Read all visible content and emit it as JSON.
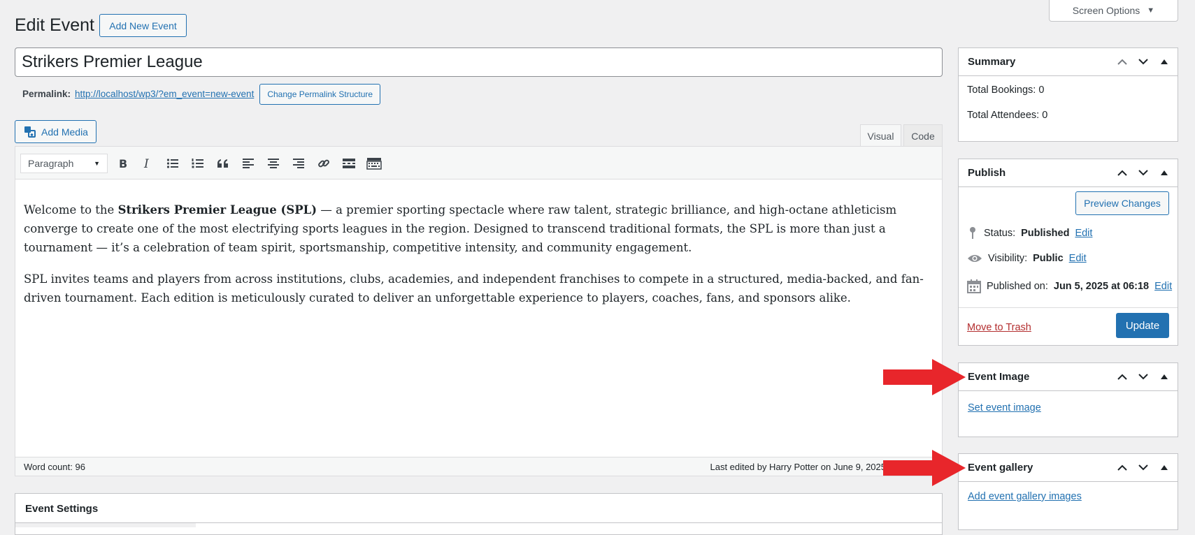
{
  "header": {
    "title": "Edit Event",
    "add_new_label": "Add New Event",
    "screen_options_label": "Screen Options"
  },
  "post": {
    "title_value": "Strikers Premier League",
    "permalink_label": "Permalink:",
    "permalink_url": "http://localhost/wp3/?em_event=new-event",
    "change_permalink_label": "Change Permalink Structure"
  },
  "editor": {
    "add_media_label": "Add Media",
    "tabs": {
      "visual": "Visual",
      "code": "Code"
    },
    "format_select_value": "Paragraph",
    "paragraph1": {
      "pre": "Welcome to the ",
      "bold": "Strikers Premier League (SPL)",
      "post": " — a premier sporting spectacle where raw talent, strategic brilliance, and high-octane athleticism converge to create one of the most electrifying sports leagues in the region. Designed to transcend traditional formats, the SPL is more than just a tournament — it’s a celebration of team spirit, sportsmanship, competitive intensity, and community engagement."
    },
    "paragraph2": "SPL invites teams and players from across institutions, clubs, academies, and independent franchises to compete in a structured, media-backed, and fan-driven tournament. Each edition is meticulously curated to deliver an unforgettable experience to players, coaches, fans, and sponsors alike.",
    "word_count": "Word count: 96",
    "last_edited": "Last edited by Harry Potter on June 9, 2025"
  },
  "event_settings": {
    "title": "Event Settings"
  },
  "sidebar": {
    "summary": {
      "title": "Summary",
      "total_bookings": "Total Bookings: 0",
      "total_attendees": "Total Attendees: 0"
    },
    "publish": {
      "title": "Publish",
      "preview_label": "Preview Changes",
      "status_label": "Status:",
      "status_value": "Published",
      "visibility_label": "Visibility:",
      "visibility_value": "Public",
      "published_label": "Published on:",
      "published_value": "Jun 5, 2025 at 06:18",
      "edit_label": "Edit",
      "trash_label": "Move to Trash",
      "update_label": "Update"
    },
    "event_image": {
      "title": "Event Image",
      "set_label": "Set event image"
    },
    "event_gallery": {
      "title": "Event gallery",
      "add_label": "Add event gallery images"
    }
  },
  "colors": {
    "accent": "#2271b1",
    "arrow": "#e8262b",
    "trash": "#b32d2e"
  }
}
